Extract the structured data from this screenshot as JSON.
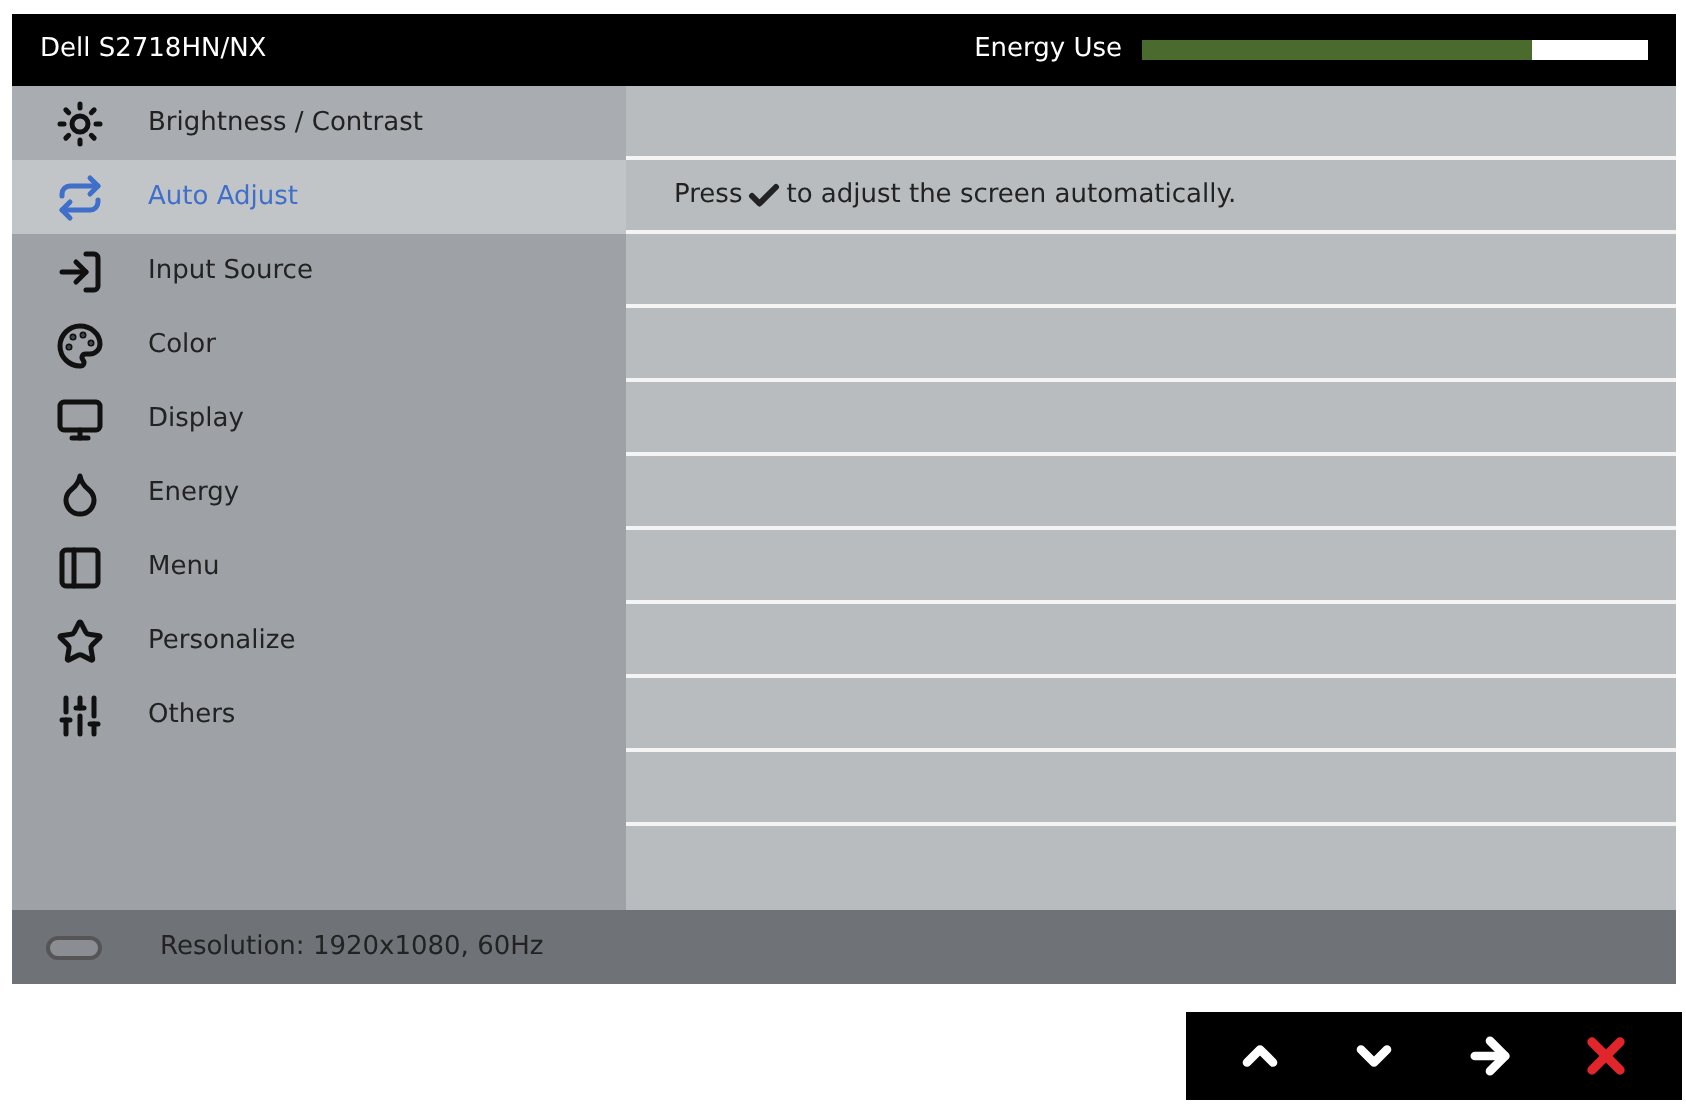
{
  "title": "Dell S2718HN/NX",
  "energy": {
    "label": "Energy Use",
    "level": 0.77
  },
  "menu": [
    {
      "label": "Brightness / Contrast",
      "selected": false
    },
    {
      "label": "Auto Adjust",
      "selected": true
    },
    {
      "label": "Input Source",
      "selected": false
    },
    {
      "label": "Color",
      "selected": false
    },
    {
      "label": "Display",
      "selected": false
    },
    {
      "label": "Energy",
      "selected": false
    },
    {
      "label": "Menu",
      "selected": false
    },
    {
      "label": "Personalize",
      "selected": false
    },
    {
      "label": "Others",
      "selected": false
    }
  ],
  "message": {
    "before": "Press",
    "after": "to adjust the screen automatically."
  },
  "status": "Resolution: 1920x1080, 60Hz"
}
